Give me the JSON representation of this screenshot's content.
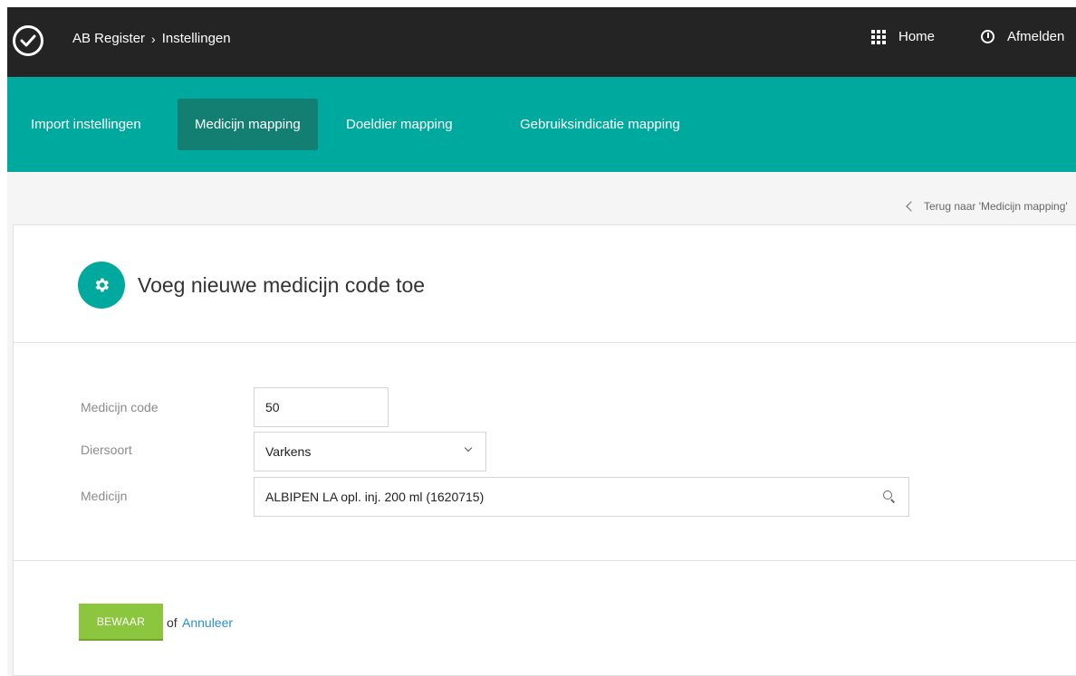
{
  "header": {
    "app_name": "AB Register",
    "separator": "›",
    "section": "Instellingen",
    "home_label": "Home",
    "logout_label": "Afmelden"
  },
  "tabs": [
    {
      "label": "Import instellingen",
      "active": false
    },
    {
      "label": "Medicijn mapping",
      "active": true
    },
    {
      "label": "Doeldier mapping",
      "active": false
    },
    {
      "label": "Gebruiksindicatie mapping",
      "active": false
    }
  ],
  "back_link": "Terug naar 'Medicijn mapping'",
  "panel": {
    "title": "Voeg nieuwe medicijn code toe",
    "icon": "gear-icon"
  },
  "form": {
    "code_label": "Medicijn code",
    "code_value": "50",
    "species_label": "Diersoort",
    "species_value": "Varkens",
    "medicine_label": "Medicijn",
    "medicine_value": "ALBIPEN LA opl. inj. 200 ml (1620715)"
  },
  "actions": {
    "save_label": "BEWAAR",
    "or_text": "of",
    "cancel_label": "Annuleer"
  },
  "colors": {
    "topbar": "#242424",
    "accent": "#00a99d",
    "active_tab": "#137f73",
    "save": "#8cc63f",
    "link": "#2a8fd4"
  }
}
